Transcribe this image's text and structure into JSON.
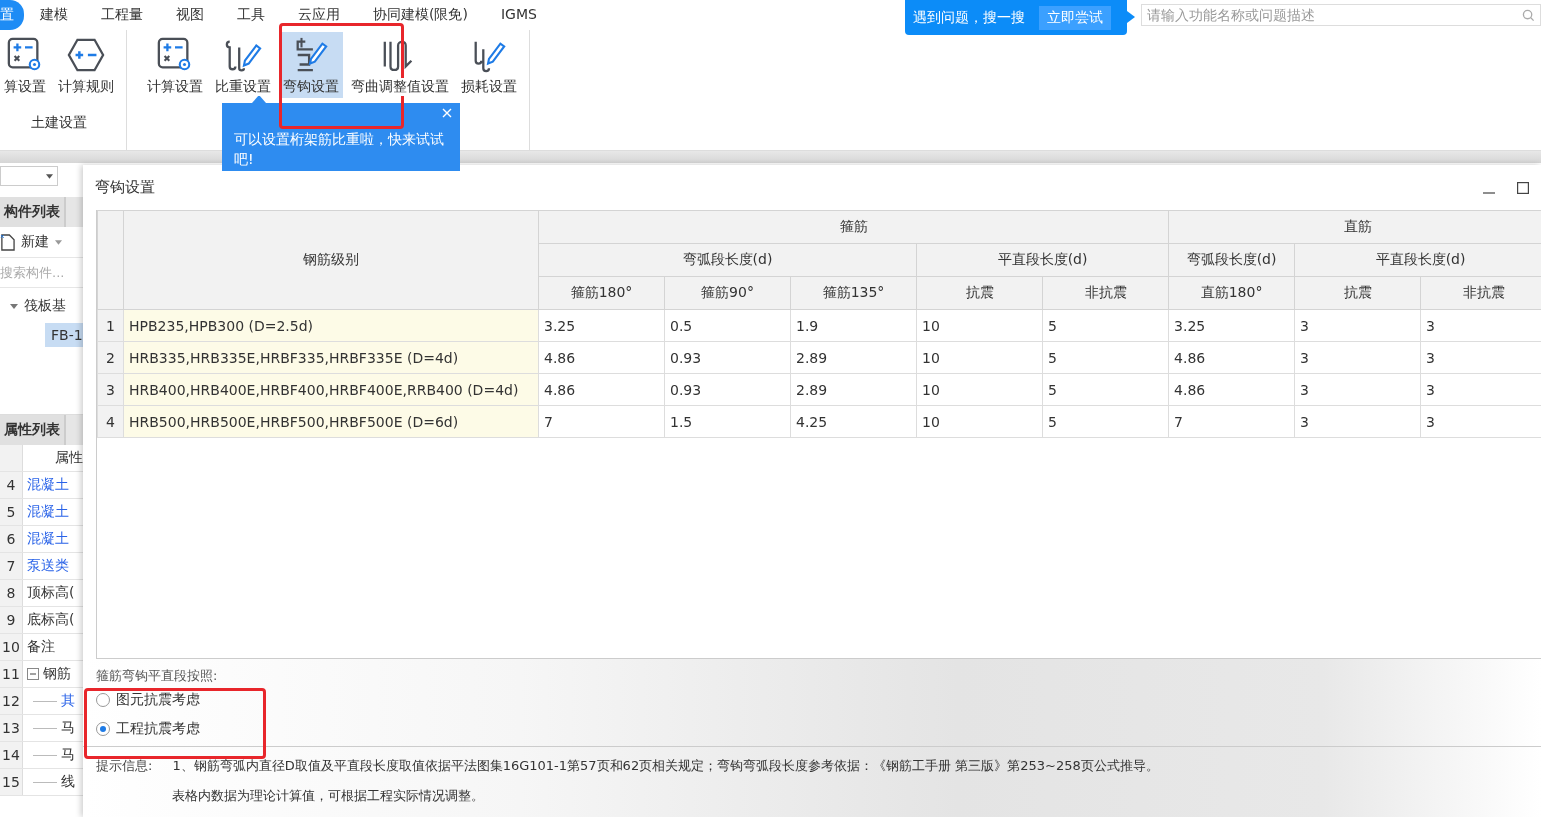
{
  "menu_tabs": [
    {
      "label": "置",
      "selected": true
    },
    {
      "label": "建模",
      "selected": false
    },
    {
      "label": "工程量",
      "selected": false
    },
    {
      "label": "视图",
      "selected": false
    },
    {
      "label": "工具",
      "selected": false
    },
    {
      "label": "云应用",
      "selected": false
    },
    {
      "label": "协同建模(限免)",
      "selected": false
    },
    {
      "label": "IGMS",
      "selected": false
    }
  ],
  "help_banner": {
    "text": "遇到问题，搜一搜",
    "button": "立即尝试"
  },
  "search": {
    "placeholder": "请输入功能名称或问题描述"
  },
  "ribbon_groups": [
    {
      "label": "土建设置",
      "buttons": [
        {
          "label": "算设置",
          "kind": "calc",
          "selected": false
        },
        {
          "label": "计算规则",
          "kind": "rule",
          "selected": false
        }
      ]
    },
    {
      "buttons": [
        {
          "label": "计算设置",
          "kind": "calc",
          "selected": false
        },
        {
          "label": "比重设置",
          "kind": "weight",
          "selected": false
        },
        {
          "label": "弯钩设置",
          "kind": "hook",
          "selected": true
        },
        {
          "label": "弯曲调整值设置",
          "kind": "bend",
          "selected": false
        },
        {
          "label": "损耗设置",
          "kind": "loss",
          "selected": false
        }
      ]
    }
  ],
  "tooltip": {
    "text": "可以设置桁架筋比重啦，快来试试吧!"
  },
  "left_panel": {
    "tab": "构件列表",
    "new_button": "新建",
    "search_placeholder": "搜索构件...",
    "tree": [
      {
        "label": "筏板基",
        "expanded": true,
        "children": [
          {
            "label": "FB-1",
            "selected": true
          }
        ]
      }
    ],
    "property_tab": "属性列表",
    "property_header": "属性",
    "properties": [
      {
        "index": "4",
        "name": "混凝土",
        "linked": true
      },
      {
        "index": "5",
        "name": "混凝土",
        "linked": true
      },
      {
        "index": "6",
        "name": "混凝土",
        "linked": true
      },
      {
        "index": "7",
        "name": "泵送类",
        "linked": true
      },
      {
        "index": "8",
        "name": "顶标高(",
        "linked": false
      },
      {
        "index": "9",
        "name": "底标高(",
        "linked": false
      },
      {
        "index": "10",
        "name": "备注",
        "linked": false
      },
      {
        "index": "11",
        "name": "钢筋",
        "linked": false,
        "expanded": true,
        "children": [
          {
            "index": "12",
            "name": "其",
            "linked": true
          },
          {
            "index": "13",
            "name": "马",
            "linked": false
          },
          {
            "index": "14",
            "name": "马",
            "linked": false
          },
          {
            "index": "15",
            "name": "线",
            "linked": false
          }
        ]
      }
    ]
  },
  "dialog": {
    "title": "弯钩设置",
    "table": {
      "row_header": "钢筋级别",
      "groups": [
        {
          "label": "箍筋",
          "subgroups": [
            {
              "label": "弯弧段长度(d)",
              "columns": [
                "箍筋180°",
                "箍筋90°",
                "箍筋135°"
              ]
            },
            {
              "label": "平直段长度(d)",
              "columns": [
                "抗震",
                "非抗震"
              ]
            }
          ]
        },
        {
          "label": "直筋",
          "subgroups": [
            {
              "label": "弯弧段长度(d)",
              "columns": [
                "直筋180°"
              ]
            },
            {
              "label": "平直段长度(d)",
              "columns": [
                "抗震",
                "非抗震"
              ]
            }
          ]
        }
      ],
      "rows": [
        {
          "index": "1",
          "grade": "HPB235,HPB300 (D=2.5d)",
          "values": [
            "3.25",
            "0.5",
            "1.9",
            "10",
            "5",
            "3.25",
            "3",
            "3"
          ]
        },
        {
          "index": "2",
          "grade": "HRB335,HRB335E,HRBF335,HRBF335E (D=4d)",
          "values": [
            "4.86",
            "0.93",
            "2.89",
            "10",
            "5",
            "4.86",
            "3",
            "3"
          ]
        },
        {
          "index": "3",
          "grade": "HRB400,HRB400E,HRBF400,HRBF400E,RRB400 (D=4d)",
          "values": [
            "4.86",
            "0.93",
            "2.89",
            "10",
            "5",
            "4.86",
            "3",
            "3"
          ]
        },
        {
          "index": "4",
          "grade": "HRB500,HRB500E,HRBF500,HRBF500E (D=6d)",
          "values": [
            "7",
            "1.5",
            "4.25",
            "10",
            "5",
            "7",
            "3",
            "3"
          ]
        }
      ]
    },
    "radio_group": {
      "label": "箍筋弯钩平直段按照:",
      "options": [
        {
          "label": "图元抗震考虑",
          "selected": false
        },
        {
          "label": "工程抗震考虑",
          "selected": true
        }
      ]
    },
    "hint": {
      "label": "提示信息:",
      "lines": [
        "1、钢筋弯弧内直径D取值及平直段长度取值依据平法图集16G101-1第57页和62页相关规定；弯钩弯弧段长度参考依据：《钢筋工手册  第三版》第253~258页公式推导。",
        "表格内数据为理论计算值，可根据工程实际情况调整。"
      ]
    }
  }
}
